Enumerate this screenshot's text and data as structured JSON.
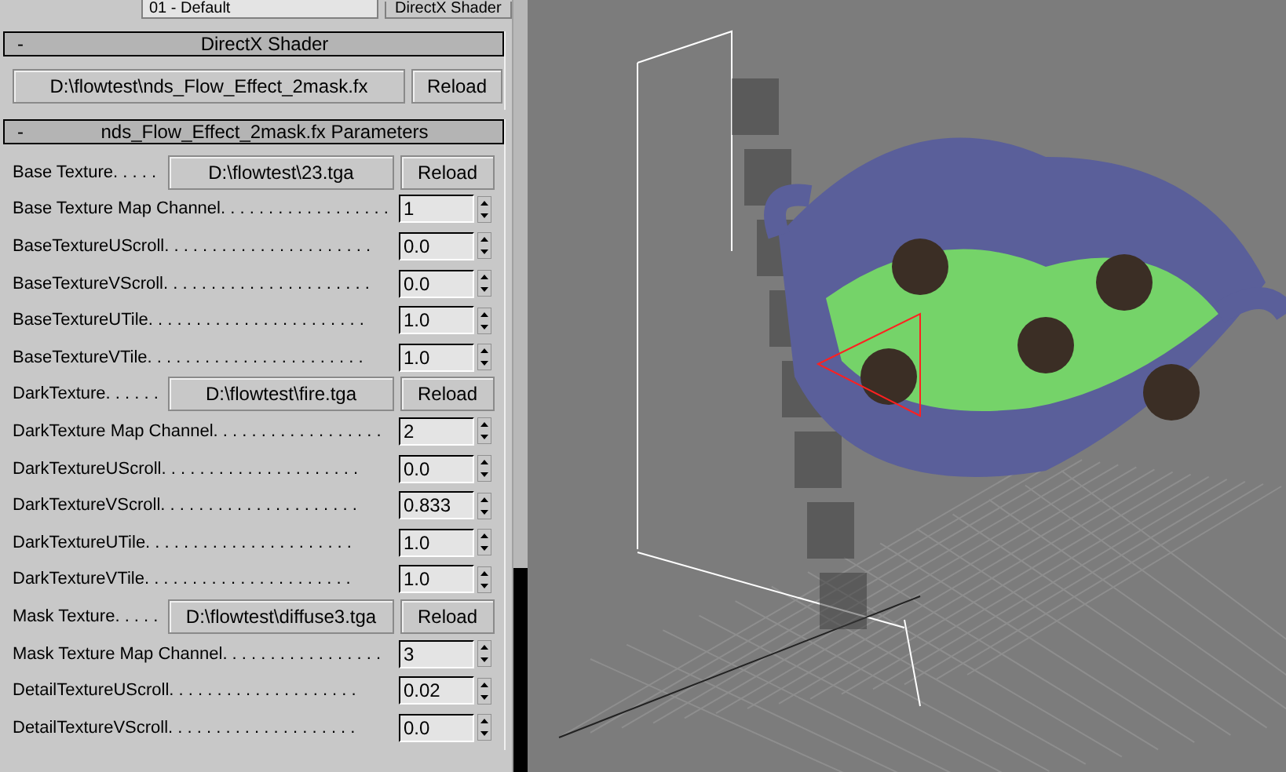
{
  "top_bar": {
    "material": "01 - Default",
    "shader_button": "DirectX Shader"
  },
  "shader_rollout": {
    "toggle": "-",
    "title": "DirectX Shader",
    "file": "D:\\flowtest\\nds_Flow_Effect_2mask.fx",
    "reload": "Reload"
  },
  "params_rollout": {
    "toggle": "-",
    "title": "nds_Flow_Effect_2mask.fx Parameters",
    "rows": [
      {
        "kind": "file",
        "label": "Base Texture. . . . .",
        "file": "D:\\flowtest\\23.tga",
        "reload": "Reload"
      },
      {
        "kind": "spinner",
        "label": "Base Texture Map Channel. . . . . . . . . . . . . . . . . .",
        "value": "1"
      },
      {
        "kind": "spinner",
        "label": "BaseTextureUScroll. . . . . . . . . . . . . . . . . . . . . .",
        "value": "0.0"
      },
      {
        "kind": "spinner",
        "label": "BaseTextureVScroll. . . . . . . . . . . . . . . . . . . . . .",
        "value": "0.0"
      },
      {
        "kind": "spinner",
        "label": "BaseTextureUTile. . . . . . . . . . . . . . . . . . . . . . .",
        "value": "1.0"
      },
      {
        "kind": "spinner",
        "label": "BaseTextureVTile. . . . . . . . . . . . . . . . . . . . . . .",
        "value": "1.0"
      },
      {
        "kind": "file",
        "label": "DarkTexture. . . . . .",
        "file": "D:\\flowtest\\fire.tga",
        "reload": "Reload"
      },
      {
        "kind": "spinner",
        "label": "DarkTexture Map Channel. . . . . . . . . . . . . . . . . .",
        "value": "2"
      },
      {
        "kind": "spinner",
        "label": "DarkTextureUScroll. . . . . . . . . . . . . . . . . . . . .",
        "value": "0.0"
      },
      {
        "kind": "spinner",
        "label": "DarkTextureVScroll. . . . . . . . . . . . . . . . . . . . .",
        "value": "0.833"
      },
      {
        "kind": "spinner",
        "label": "DarkTextureUTile. . . . . . . . . . . . . . . . . . . . . .",
        "value": "1.0"
      },
      {
        "kind": "spinner",
        "label": "DarkTextureVTile. . . . . . . . . . . . . . . . . . . . . .",
        "value": "1.0"
      },
      {
        "kind": "file",
        "label": "Mask Texture. . . . .",
        "file": "D:\\flowtest\\diffuse3.tga",
        "reload": "Reload"
      },
      {
        "kind": "spinner",
        "label": "Mask Texture Map Channel. . . . . . . . . . . . . . . . .",
        "value": "3"
      },
      {
        "kind": "spinner",
        "label": "DetailTextureUScroll. . . . . . . . . . . . . . . . . . . .",
        "value": "0.02"
      },
      {
        "kind": "spinner",
        "label": "DetailTextureVScroll. . . . . . . . . . . . . . . . . . . .",
        "value": "0.0"
      }
    ]
  }
}
